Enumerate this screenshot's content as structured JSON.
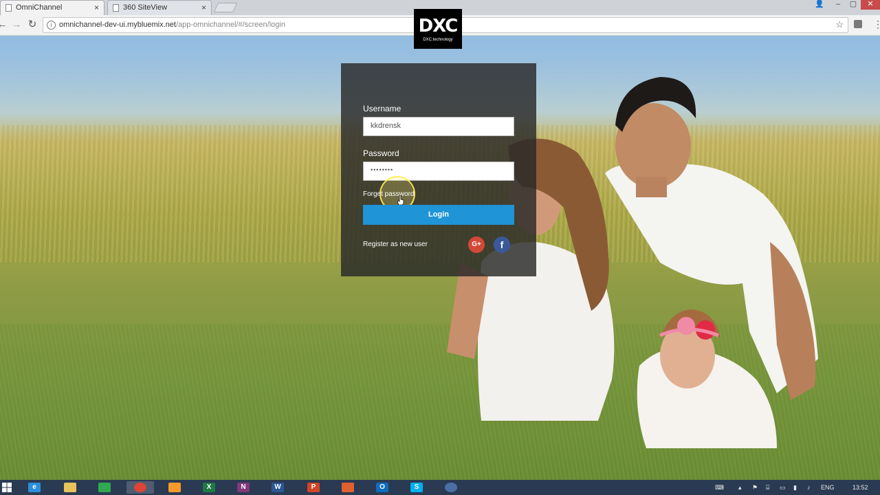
{
  "browser": {
    "tabs": [
      {
        "title": "OmniChannel",
        "active": true
      },
      {
        "title": "360 SiteView",
        "active": false
      }
    ],
    "close_glyph": "×",
    "url_host": "omnichannel-dev-ui.mybluemix.net",
    "url_path": "/app-omnichannel/#/screen/login",
    "back_glyph": "←",
    "forward_glyph": "→",
    "reload_glyph": "↻",
    "star_glyph": "☆",
    "menu_glyph": "⋮",
    "info_glyph": "i",
    "window_controls": {
      "user": "👤",
      "minimize": "–",
      "maximize": "▢",
      "close": "✕"
    }
  },
  "logo": {
    "mark": "DXC",
    "subtitle": "DXC.technology"
  },
  "login": {
    "username_label": "Username",
    "username_value": "kkdrensk",
    "password_label": "Password",
    "password_value": "••••••••",
    "forgot_label": "Forget password",
    "login_button": "Login",
    "register_label": "Register as new user",
    "google_label": "G+",
    "facebook_label": "f"
  },
  "taskbar": {
    "apps": [
      {
        "name": "internet-explorer",
        "glyph": "e",
        "color": "#2b8fd9"
      },
      {
        "name": "file-explorer",
        "glyph": "",
        "color": "#e8c35a"
      },
      {
        "name": "store",
        "glyph": "",
        "color": "#2fa84f"
      },
      {
        "name": "chrome",
        "glyph": "",
        "color": "#db4437"
      },
      {
        "name": "app-orange",
        "glyph": "",
        "color": "#f39a2b"
      },
      {
        "name": "excel",
        "glyph": "X",
        "color": "#1f7a45"
      },
      {
        "name": "onenote",
        "glyph": "N",
        "color": "#80397b"
      },
      {
        "name": "word",
        "glyph": "W",
        "color": "#2b5797"
      },
      {
        "name": "powerpoint",
        "glyph": "P",
        "color": "#d04525"
      },
      {
        "name": "tool-app",
        "glyph": "",
        "color": "#e06030"
      },
      {
        "name": "outlook",
        "glyph": "O",
        "color": "#0f6cbd"
      },
      {
        "name": "skype",
        "glyph": "S",
        "color": "#00aff0"
      },
      {
        "name": "cortana",
        "glyph": "",
        "color": "#4a6fa5"
      }
    ],
    "language": "ENG",
    "time": "13:52"
  },
  "colors": {
    "accent": "#1f94d6",
    "card_bg": "rgba(40,40,40,0.82)"
  }
}
